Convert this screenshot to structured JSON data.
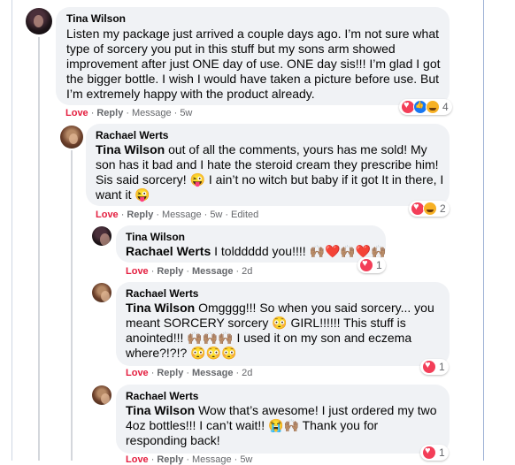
{
  "comments": [
    {
      "author": "Tina Wilson",
      "text": "Listen my package just arrived a couple days ago. I’m not sure what type of sorcery you put in this stuff but my sons arm showed improvement after just ONE day of use. ONE day sis!!! I’m glad I got the bigger bottle. I wish I would have taken a picture before use. But I’m extremely happy with the product already.",
      "action_love": "Love",
      "action_reply": "Reply",
      "action_message": "Message",
      "time": "5w",
      "reaction_count": "4"
    },
    {
      "author": "Rachael Werts",
      "mention": "Tina Wilson",
      "text_line1": "out of all the comments, yours has me sold! My",
      "text_line2": "son has it bad and I hate the steroid cream they prescribe him!",
      "text_line3a": "Sis said sorcery! 😜 I ain’t no witch but baby if it got It in there, I",
      "text_line4": "want it 😜",
      "action_love": "Love",
      "action_reply": "Reply",
      "action_message": "Message",
      "time": "5w",
      "edited": "Edited",
      "reaction_count": "2"
    },
    {
      "author": "Tina Wilson",
      "mention": "Rachael Werts",
      "text": "I tolddddd you!!!! 🙌🏽❤️🙌🏽❤️🙌🏽",
      "action_love": "Love",
      "action_reply": "Reply",
      "action_message": "Message",
      "time": "2d",
      "reaction_count": "1"
    },
    {
      "author": "Rachael Werts",
      "mention": "Tina Wilson",
      "text_line1": "Omgggg!!! So when you said sorcery... you",
      "text_line2": "meant SORCERY sorcery 😳 GIRL!!!!!! This stuff is",
      "text_line3": "anointed!!! 🙌🏽🙌🏽🙌🏽 I used it on my son and eczema",
      "text_line4": "where?!?!? 😳😳😳",
      "action_love": "Love",
      "action_reply": "Reply",
      "action_message": "Message",
      "time": "2d",
      "reaction_count": "1"
    },
    {
      "author": "Rachael Werts",
      "mention": "Tina Wilson",
      "text_line1": "Wow that’s awesome! I just ordered my two",
      "text_line2": "4oz bottles!!! I can’t wait!! 😭🙌🏽 Thank you for",
      "text_line3": "responding back!",
      "action_love": "Love",
      "action_reply": "Reply",
      "action_message": "Message",
      "time": "5w",
      "reaction_count": "1"
    }
  ],
  "colors": {
    "love": "#e41e3f",
    "bubble": "#f0f2f5",
    "meta": "#65676b"
  }
}
